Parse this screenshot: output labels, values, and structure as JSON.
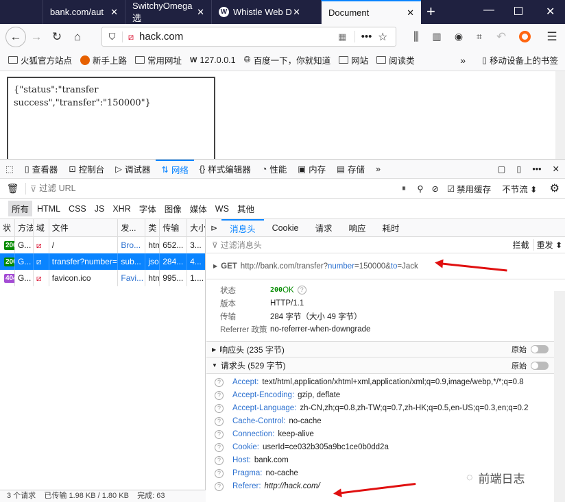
{
  "browser": {
    "tabs": [
      {
        "title": "bank.com/aut"
      },
      {
        "title": "SwitchyOmega 选"
      },
      {
        "title": "Whistle Web D"
      },
      {
        "title": "Document",
        "active": true
      }
    ],
    "url": "hack.com",
    "bookmarks": [
      "火狐官方站点",
      "新手上路",
      "常用网址",
      "127.0.0.1",
      "百度一下，你就知道",
      "网站",
      "阅读类"
    ],
    "mobile_bookmarks": "移动设备上的书签",
    "accent": "#0a84ff"
  },
  "page": {
    "line1": "{\"status\":\"transfer",
    "line2": "success\",\"transfer\":\"150000\"}"
  },
  "devtools": {
    "tools": [
      "查看器",
      "控制台",
      "调试器",
      "网络",
      "样式编辑器",
      "性能",
      "内存",
      "存储"
    ],
    "active_tool": "网络",
    "filter_placeholder": "过滤 URL",
    "disable_cache": "禁用缓存",
    "throttle": "不节流",
    "types": [
      "所有",
      "HTML",
      "CSS",
      "JS",
      "XHR",
      "字体",
      "图像",
      "媒体",
      "WS",
      "其他"
    ],
    "columns": [
      "状",
      "方法",
      "域",
      "文件",
      "发...",
      "类",
      "传输",
      "大小"
    ],
    "requests": [
      {
        "status": "200",
        "status_color": "#058b00",
        "method": "G...",
        "file": "/",
        "cause": "Bro...",
        "type": "htm",
        "transferred": "652...",
        "size": "3..."
      },
      {
        "status": "200",
        "status_color": "#058b00",
        "method": "G...",
        "file": "transfer?number=",
        "cause": "sub...",
        "type": "json",
        "transferred": "284...",
        "size": "4...",
        "selected": true
      },
      {
        "status": "404",
        "status_color": "#a44cd4",
        "method": "G...",
        "file": "favicon.ico",
        "cause": "Favi...",
        "type": "htm",
        "transferred": "995...",
        "size": "1...."
      }
    ],
    "status_bar": "3 个请求    已传输 1.98 KB / 1.80 KB    完成: 63",
    "detail_tabs": [
      "消息头",
      "Cookie",
      "请求",
      "响应",
      "耗时"
    ],
    "detail_filter": "过滤消息头",
    "block": "拦截",
    "resend": "重发",
    "get": {
      "method": "GET",
      "base": "http://bank.com/transfer",
      "q1": "?",
      "k1": "number",
      "e1": "=150000",
      "amp": "&",
      "k2": "to",
      "e2": "=Jack"
    },
    "summary": [
      {
        "k": "状态",
        "v": "OK",
        "code": "200"
      },
      {
        "k": "版本",
        "v": "HTTP/1.1"
      },
      {
        "k": "传输",
        "v": "284 字节（大小 49 字节）"
      },
      {
        "k": "Referrer 政策",
        "v": "no-referrer-when-downgrade"
      }
    ],
    "response_headers": "响应头 (235 字节)",
    "request_headers": "请求头 (529 字节)",
    "raw": "原始",
    "headers": [
      {
        "n": "Accept:",
        "v": "text/html,application/xhtml+xml,application/xml;q=0.9,image/webp,*/*;q=0.8"
      },
      {
        "n": "Accept-Encoding:",
        "v": "gzip, deflate"
      },
      {
        "n": "Accept-Language:",
        "v": "zh-CN,zh;q=0.8,zh-TW;q=0.7,zh-HK;q=0.5,en-US;q=0.3,en;q=0.2"
      },
      {
        "n": "Cache-Control:",
        "v": "no-cache"
      },
      {
        "n": "Connection:",
        "v": "keep-alive"
      },
      {
        "n": "Cookie:",
        "v": "userId=ce032b305a9bc1ce0b0dd2a"
      },
      {
        "n": "Host:",
        "v": "bank.com"
      },
      {
        "n": "Pragma:",
        "v": "no-cache"
      },
      {
        "n": "Referer:",
        "v": "http://hack.com/"
      }
    ]
  },
  "watermark": "前端日志"
}
